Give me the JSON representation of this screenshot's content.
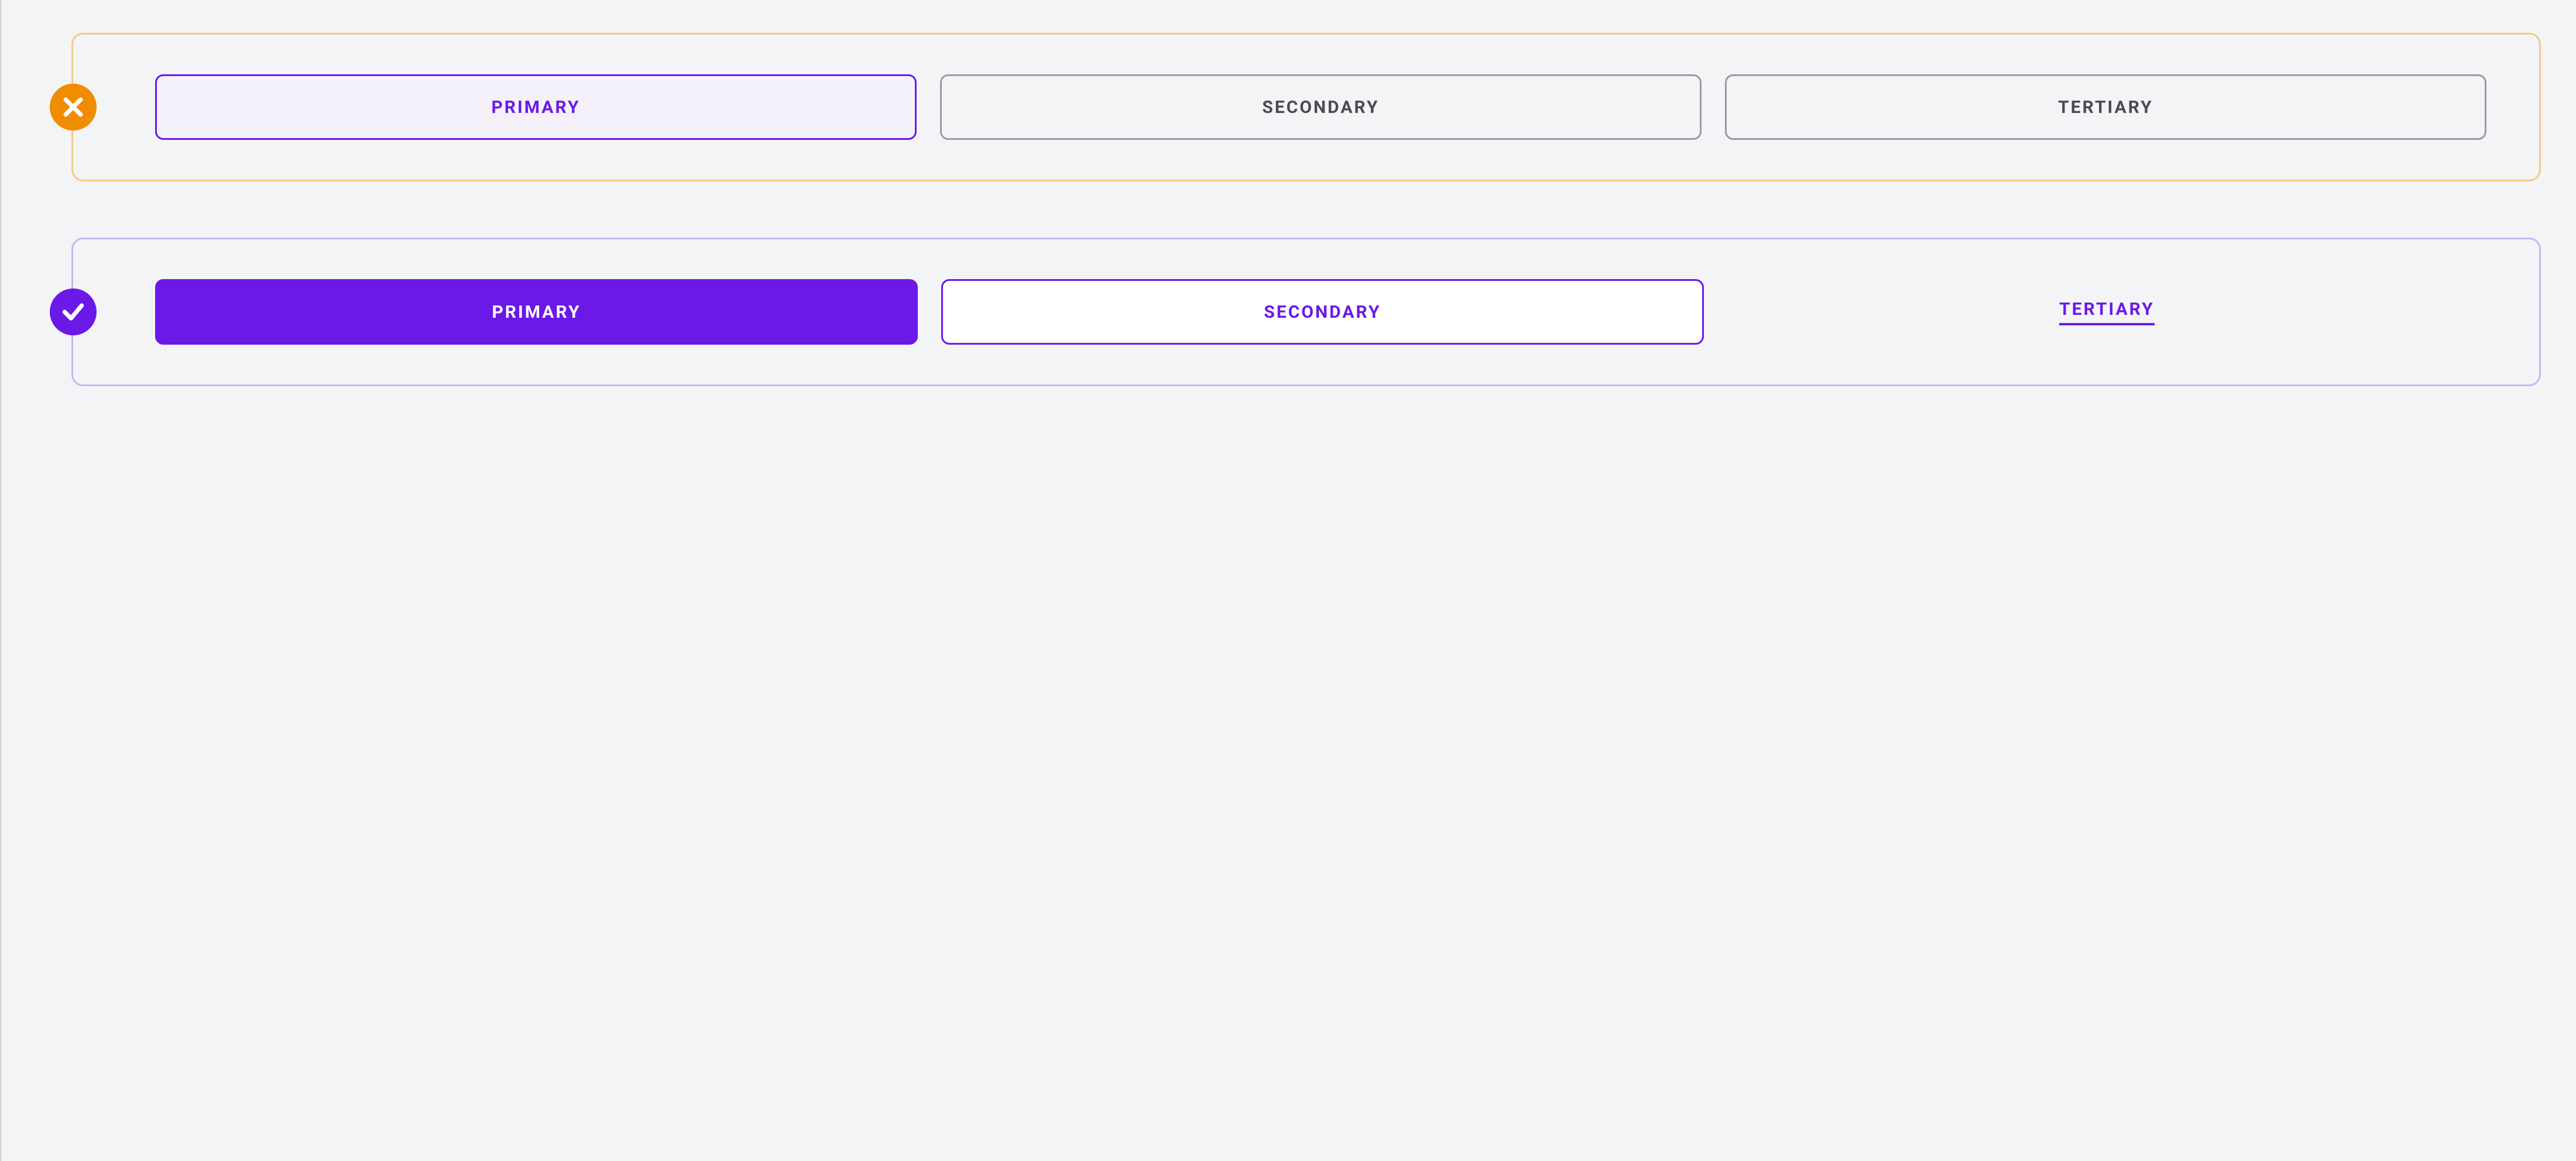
{
  "colors": {
    "purple": "#6a19e8",
    "orange": "#f08c00",
    "gray_text": "#4a4a55",
    "gray_border": "#9a9aa2",
    "dont_border": "#f6c986",
    "do_border": "#c6b6f2",
    "bg": "#f3f4f6"
  },
  "dont": {
    "icon": "cross-icon",
    "buttons": [
      {
        "label": "PRIMARY",
        "style": "outline-purple"
      },
      {
        "label": "SECONDARY",
        "style": "outline-gray"
      },
      {
        "label": "TERTIARY",
        "style": "outline-gray"
      }
    ]
  },
  "do": {
    "icon": "check-icon",
    "buttons": [
      {
        "label": "PRIMARY",
        "style": "solid-purple"
      },
      {
        "label": "SECONDARY",
        "style": "outline-purple"
      },
      {
        "label": "TERTIARY",
        "style": "link-purple"
      }
    ]
  }
}
